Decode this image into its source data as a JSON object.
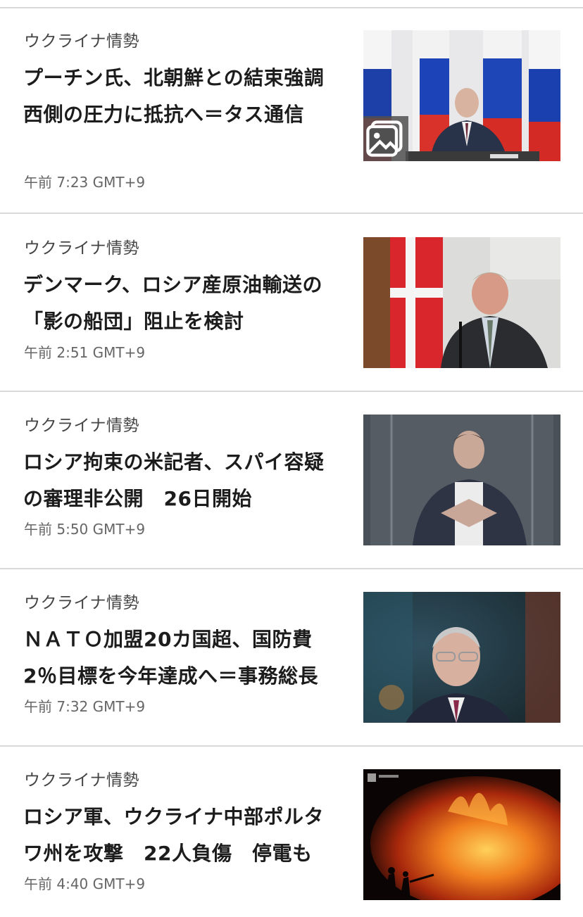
{
  "articles": [
    {
      "category": "ウクライナ情勢",
      "headline": "プーチン氏、北朝鮮との結束強調　西側の圧力に抵抗へ＝タス通信",
      "time": "午前 7:23 GMT+9",
      "image_icon": "putin-press-photo",
      "has_gallery": true
    },
    {
      "category": "ウクライナ情勢",
      "headline": "デンマーク、ロシア産原油輸送の「影の船団」阻止を検討",
      "time": "午前 2:51 GMT+9",
      "image_icon": "danish-minister-photo",
      "has_gallery": false
    },
    {
      "category": "ウクライナ情勢",
      "headline": "ロシア拘束の米記者、スパイ容疑の審理非公開　26日開始",
      "time": "午前 5:50 GMT+9",
      "image_icon": "journalist-courtroom-photo",
      "has_gallery": false
    },
    {
      "category": "ウクライナ情勢",
      "headline": "ＮＡＴＯ加盟20カ国超、国防費2％目標を今年達成へ＝事務総長",
      "time": "午前 7:32 GMT+9",
      "image_icon": "nato-secretary-general-photo",
      "has_gallery": false
    },
    {
      "category": "ウクライナ情勢",
      "headline": "ロシア軍、ウクライナ中部ポルタワ州を攻撃　22人負傷　停電も",
      "time": "午前 4:40 GMT+9",
      "image_icon": "fire-attack-photo",
      "has_gallery": false
    }
  ]
}
